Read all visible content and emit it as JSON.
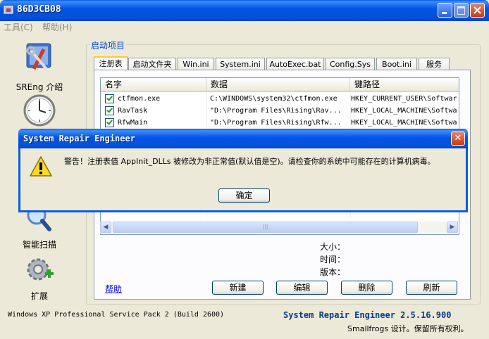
{
  "window": {
    "title": "86D3CB08"
  },
  "menu": [
    "工具(C)",
    "帮助(H)"
  ],
  "nav": [
    {
      "label": "SREng 介绍",
      "icon": "tools-icon"
    },
    {
      "label": "",
      "icon": "clock-icon"
    },
    {
      "label": "智能扫描",
      "icon": "magnifier-icon"
    },
    {
      "label": "扩展",
      "icon": "gear-plus-icon"
    }
  ],
  "group": {
    "title": "启动项目"
  },
  "tabs": [
    "注册表",
    "启动文件夹",
    "Win.ini",
    "System.ini",
    "AutoExec.bat",
    "Config.Sys",
    "Boot.ini",
    "服务"
  ],
  "list": {
    "columns": [
      "名字",
      "数据",
      "键路径"
    ],
    "rows": [
      {
        "name": "ctfmon.exe",
        "data": "C:\\WINDOWS\\system32\\ctfmon.exe",
        "path": "HKEY_CURRENT_USER\\Softwar"
      },
      {
        "name": "RavTask",
        "data": "\"D:\\Program Files\\Rising\\Rav...",
        "path": "HKEY_LOCAL_MACHINE\\Softwa"
      },
      {
        "name": "RfwMain",
        "data": "\"D:\\Program Files\\Rising\\Rfw...",
        "path": "HKEY_LOCAL_MACHINE\\Softwa"
      }
    ]
  },
  "info": {
    "size": "大小：",
    "time": "时间：",
    "version": "版本："
  },
  "help_link": "帮助",
  "buttons": {
    "new": "新建",
    "edit": "编辑",
    "delete": "删除",
    "refresh": "刷新"
  },
  "status": {
    "os": "Windows XP Professional Service Pack 2 (Build 2600)",
    "product": "System Repair Engineer 2.5.16.900",
    "copyright": "Smallfrogs 设计。保留所有权利。"
  },
  "dialog": {
    "title": "System Repair Engineer",
    "message": "警告！注册表值 AppInit_DLLs 被修改为非正常值(默认值是空)。请检查你的系统中可能存在的计算机病毒。",
    "ok": "确定",
    "close_glyph": "✕"
  }
}
